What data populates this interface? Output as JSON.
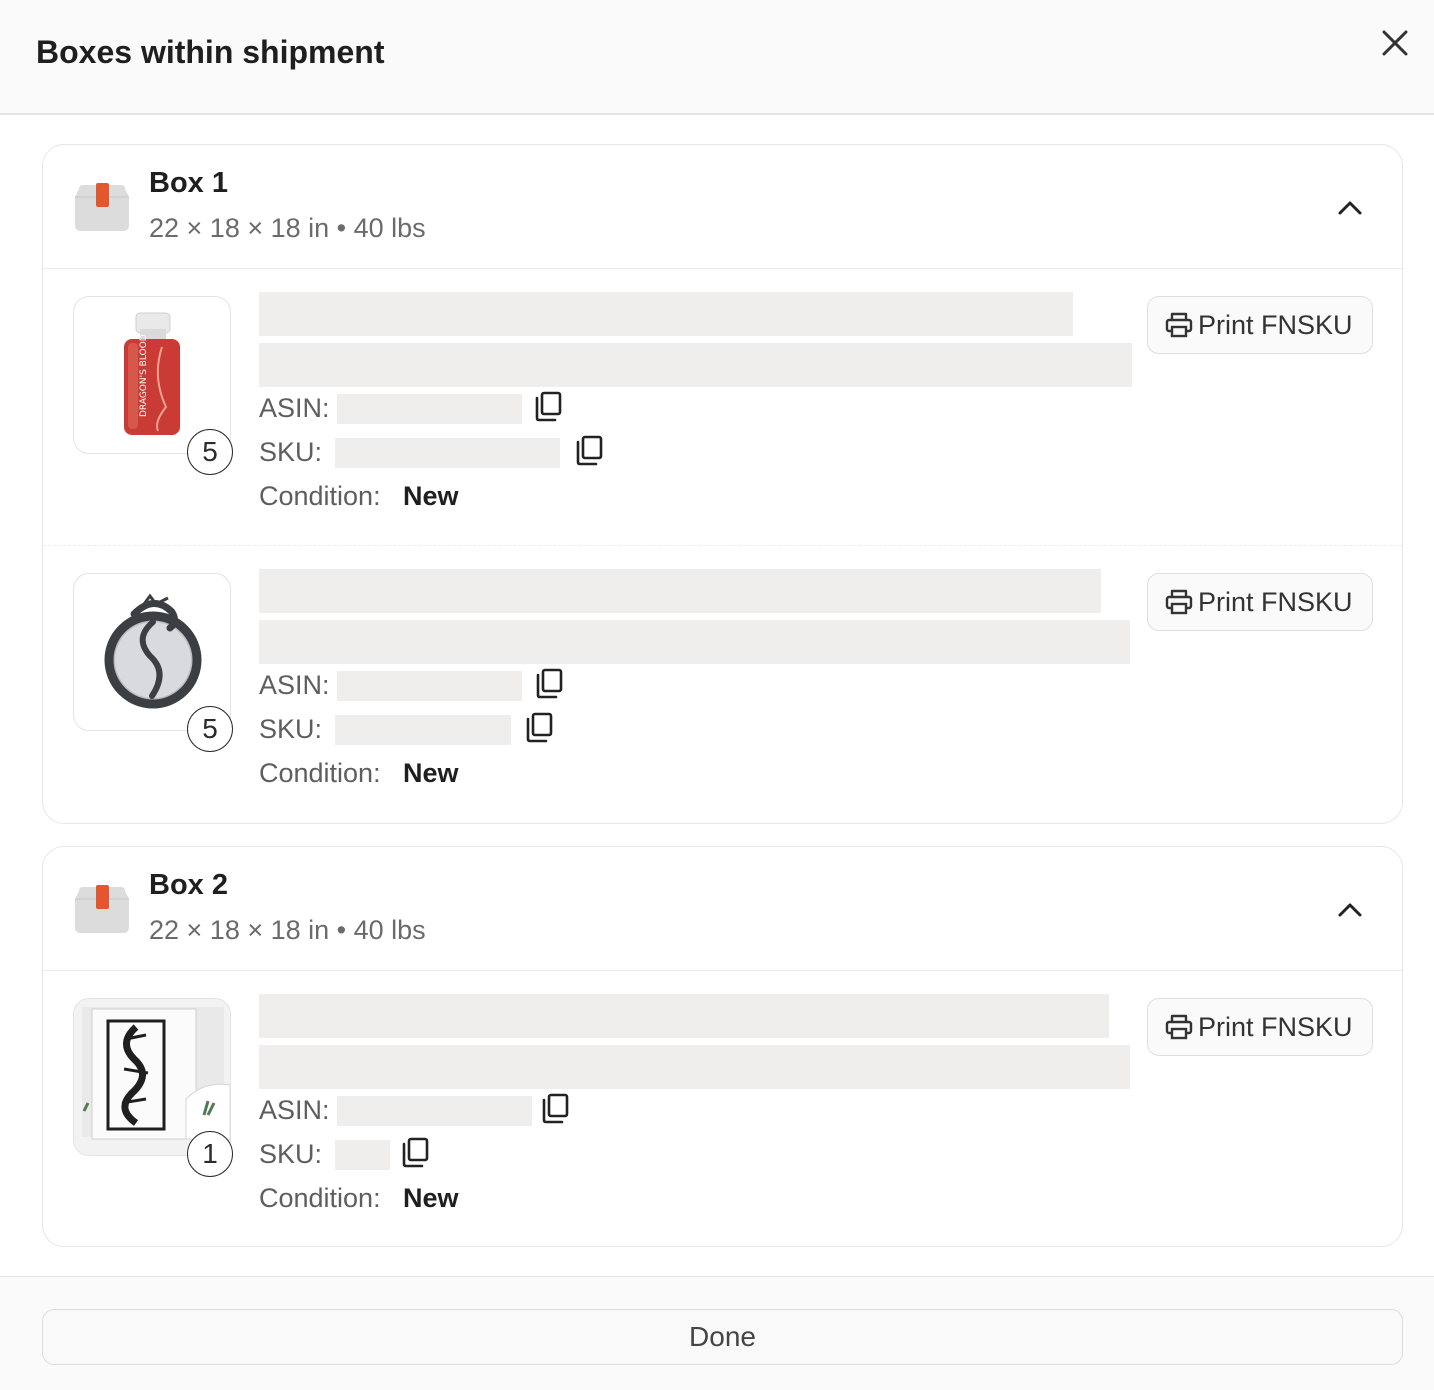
{
  "modal": {
    "title": "Boxes within shipment",
    "done_label": "Done"
  },
  "labels": {
    "asin": "ASIN:",
    "sku": "SKU:",
    "condition": "Condition:",
    "print_fnsku": "Print FNSKU"
  },
  "icons": {
    "close": "close-icon",
    "box": "box-icon",
    "collapse": "chevron-up-icon",
    "copy": "copy-icon",
    "print": "printer-icon"
  },
  "colors": {
    "box_tape": "#e4572e",
    "placeholder": "#efeeed"
  },
  "boxes": [
    {
      "name": "Box 1",
      "meta": "22 × 18 × 18 in • 40 lbs",
      "items": [
        {
          "quantity": "5",
          "condition": "New",
          "image": "red-bottle",
          "thumb_label": "DRAGON'S BLOOD"
        },
        {
          "quantity": "5",
          "condition": "New",
          "image": "dragon-mirror"
        }
      ]
    },
    {
      "name": "Box 2",
      "meta": "22 × 18 × 18 in • 40 lbs",
      "items": [
        {
          "quantity": "1",
          "condition": "New",
          "image": "dragon-door"
        }
      ]
    }
  ]
}
